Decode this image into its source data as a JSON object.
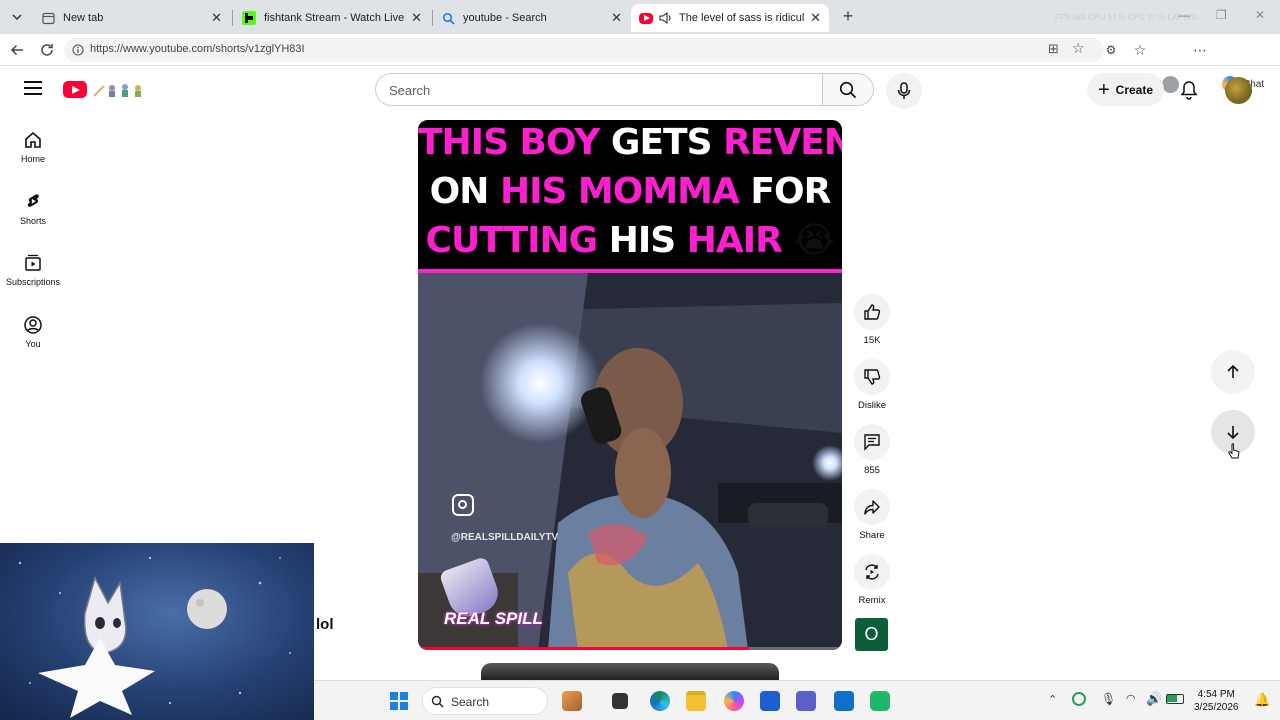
{
  "browser": {
    "tabs": [
      {
        "title": "New tab",
        "active": false
      },
      {
        "title": "fishtank Stream - Watch Live on Ki",
        "active": false
      },
      {
        "title": "youtube - Search",
        "active": false
      },
      {
        "title": "The level of sass is ridiculous",
        "active": true
      }
    ],
    "new_tab_glyph": "+",
    "url": "https://www.youtube.com/shorts/v1zglYH83I",
    "chat_label": "Chat",
    "perf_overlay": "FPS N/A   GPU 37 %   CPU 37 %   LAT N/A"
  },
  "youtube": {
    "search_placeholder": "Search",
    "create_label": "Create",
    "guide": [
      {
        "label": "Home",
        "icon": "home-icon"
      },
      {
        "label": "Shorts",
        "icon": "shorts-icon"
      },
      {
        "label": "Subscriptions",
        "icon": "subscriptions-icon"
      },
      {
        "label": "You",
        "icon": "you-icon"
      }
    ],
    "short": {
      "caption_lines": [
        [
          {
            "text": "THIS BOY ",
            "color": "pink"
          },
          {
            "text": "GETS ",
            "color": "white"
          },
          {
            "text": "REVENGE",
            "color": "pink"
          }
        ],
        [
          {
            "text": "ON ",
            "color": "white"
          },
          {
            "text": "HIS MOMMA ",
            "color": "pink"
          },
          {
            "text": "FOR",
            "color": "white"
          }
        ],
        [
          {
            "text": "CUTTING ",
            "color": "pink"
          },
          {
            "text": "HIS ",
            "color": "white"
          },
          {
            "text": "HAIR ",
            "color": "pink"
          },
          {
            "text": "😭",
            "color": "white"
          }
        ]
      ],
      "watermark_handle": "@REALSPILLDAILYTV",
      "brand_logo_text": "REAL SPILL",
      "progress": 0.78
    },
    "actions": [
      {
        "name": "like",
        "label": "15K"
      },
      {
        "name": "dislike",
        "label": "Dislike"
      },
      {
        "name": "comments",
        "label": "855"
      },
      {
        "name": "share",
        "label": "Share"
      },
      {
        "name": "remix",
        "label": "Remix"
      }
    ],
    "channel_avatar_letter": "O"
  },
  "overlay": {
    "side_text": "lol"
  },
  "taskbar": {
    "search_label": "Search",
    "time": "4:54 PM",
    "date": "3/25/2026"
  },
  "colors": {
    "yt_red": "#ff0033",
    "caption_pink": "#ff1fd0",
    "avatar_green": "#0d5c3a"
  }
}
